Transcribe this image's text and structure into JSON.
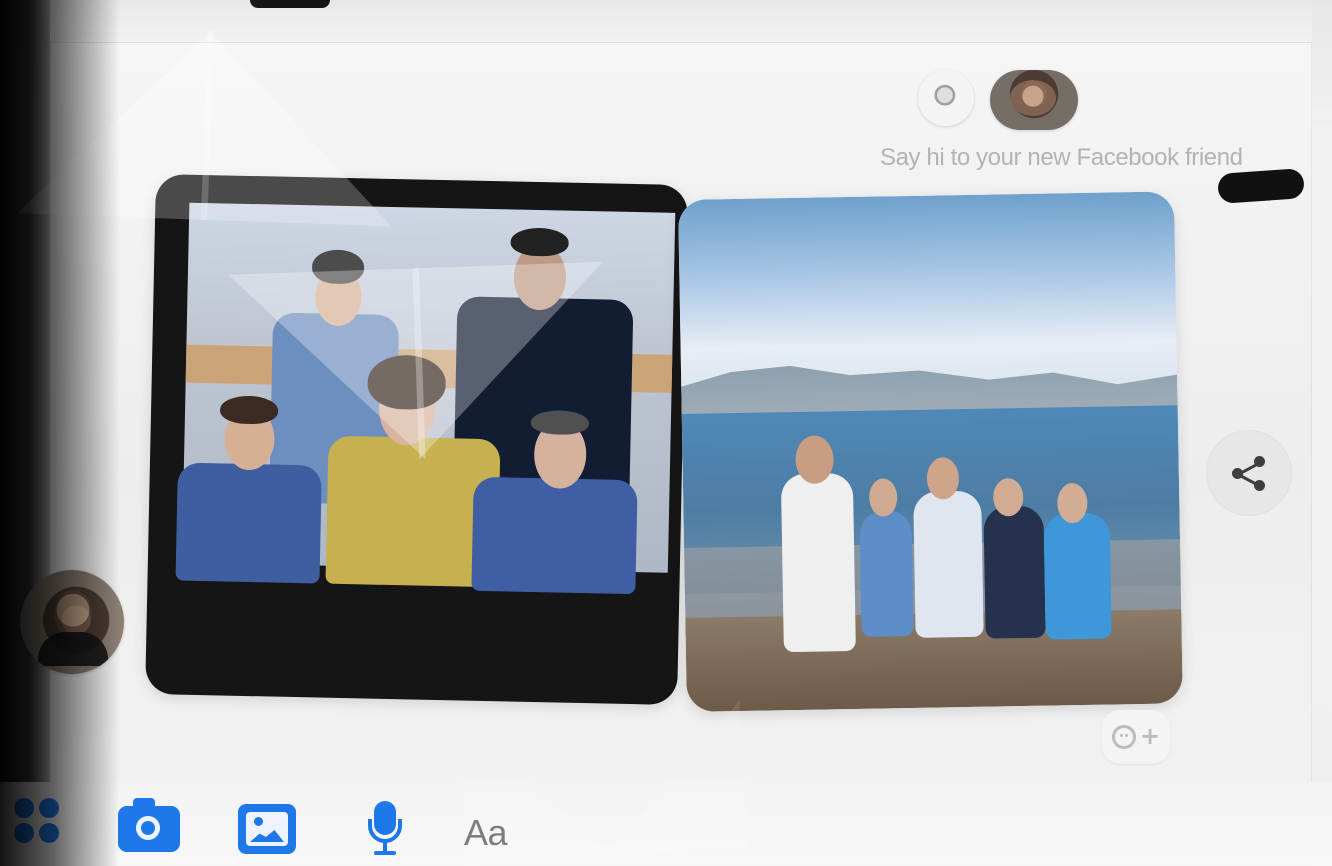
{
  "chat": {
    "intro_text": "Say hi to your new Facebook friend"
  },
  "composer": {
    "placeholder": "Aa"
  },
  "icons": {
    "menu": "grid-menu-icon",
    "camera": "camera-icon",
    "gallery": "gallery-icon",
    "mic": "microphone-icon",
    "share": "share-icon",
    "reaction": "add-reaction-icon"
  },
  "colors": {
    "accent": "#1f78e7",
    "text_muted": "#b3b3b3",
    "composer_text": "#6f6f6f"
  }
}
